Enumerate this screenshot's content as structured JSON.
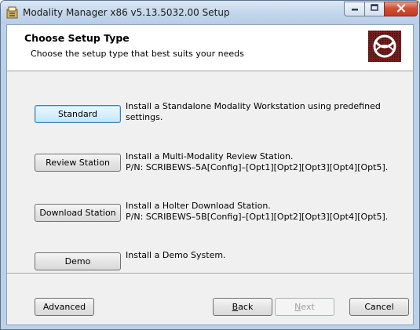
{
  "window": {
    "title": "Modality Manager x86 v5.13.5032.00 Setup"
  },
  "banner": {
    "title": "Choose Setup Type",
    "subtitle": "Choose the setup type that best suits your needs"
  },
  "options": [
    {
      "label": "Standard",
      "desc_line1": "Install a Standalone Modality Workstation using predefined",
      "desc_line2": "settings."
    },
    {
      "label": "Review Station",
      "desc_line1": "Install a Multi-Modality Review Station.",
      "desc_line2": "P/N: SCRIBEWS–5A[Config]–[Opt1][Opt2][Opt3][Opt4][Opt5]."
    },
    {
      "label": "Download Station",
      "desc_line1": "Install a Holter Download Station.",
      "desc_line2": "P/N: SCRIBEWS–5B[Config]–[Opt1][Opt2][Opt3][Opt4][Opt5]."
    },
    {
      "label": "Demo",
      "desc_line1": "Install a Demo System."
    }
  ],
  "footer": {
    "advanced": "Advanced",
    "back_first": "B",
    "back_rest": "ack",
    "next_first": "N",
    "next_rest": "ext",
    "cancel": "Cancel"
  },
  "icons": {
    "app": "installer-package-icon",
    "logo": "setup-logo-icon",
    "minimize": "minimize-icon",
    "maximize": "maximize-icon",
    "close": "close-icon"
  },
  "colors": {
    "title_bar": "#c3d6ec",
    "close_button": "#c9452a",
    "focus_border": "#3c7fb1",
    "logo_bg": "#7a1f1f"
  }
}
